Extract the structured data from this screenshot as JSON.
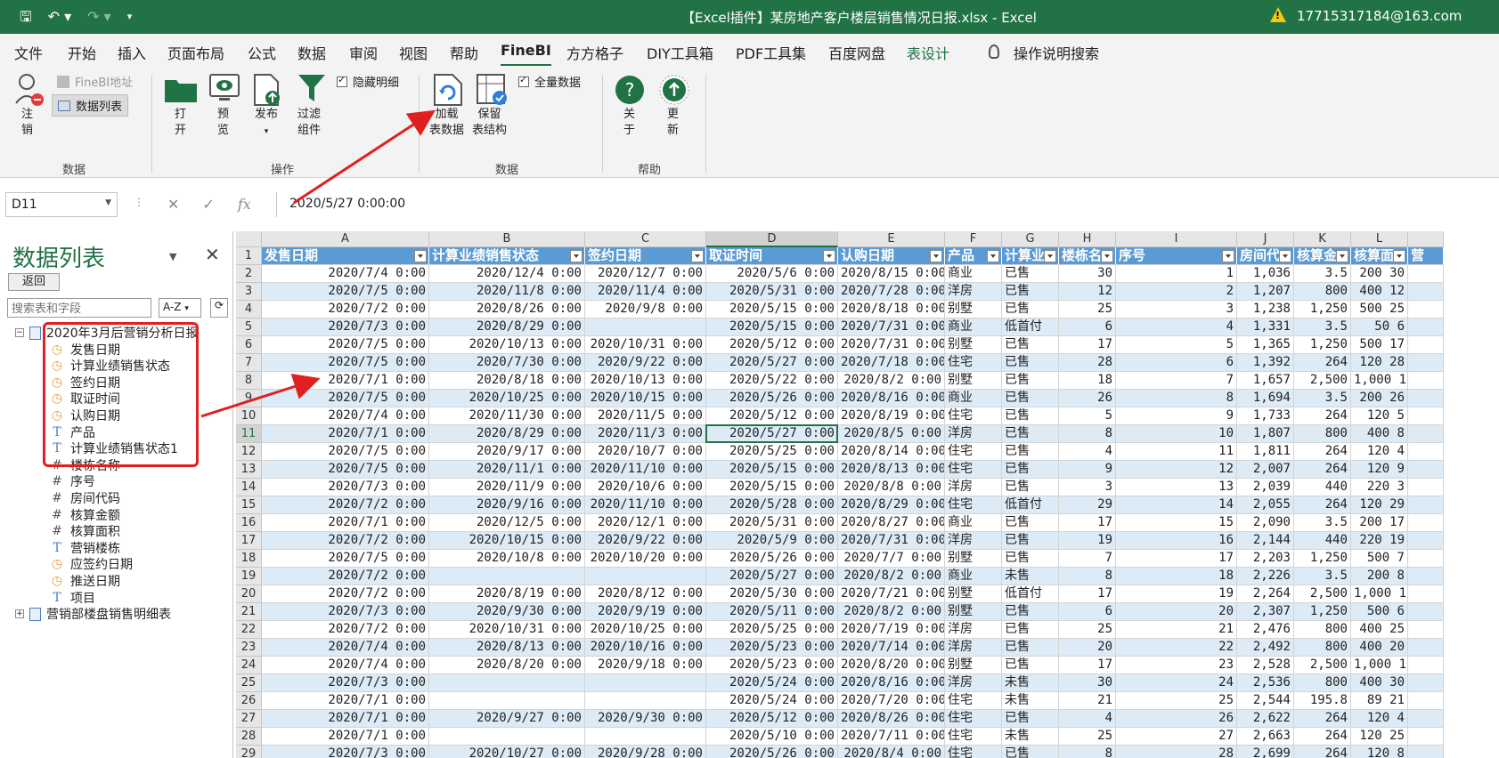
{
  "titlebar": {
    "title": "【Excel插件】某房地产客户楼层销售情况日报.xlsx  -  Excel",
    "user": "17715317184@163.com",
    "qat": [
      "save-icon",
      "undo-icon",
      "redo-icon",
      "customize-icon"
    ]
  },
  "menu": {
    "tabs": [
      "文件",
      "开始",
      "插入",
      "页面布局",
      "公式",
      "数据",
      "审阅",
      "视图",
      "帮助",
      "FineBI",
      "方方格子",
      "DIY工具箱",
      "PDF工具集",
      "百度网盘",
      "表设计"
    ],
    "active": "FineBI",
    "search": "操作说明搜索"
  },
  "ribbon": {
    "groups": {
      "data": "数据",
      "ops": "操作",
      "data2": "数据",
      "help": "帮助"
    },
    "buttons": {
      "logout": "注\n销",
      "finebi_addr": "FineBI地址",
      "data_list": "数据列表",
      "open": "打\n开",
      "preview": "预\n览",
      "publish": "发布",
      "filter": "过滤\n组件",
      "hide_detail": "隐藏明细",
      "load": "加载\n表数据",
      "keep": "保留\n表结构",
      "all_data": "全量数据",
      "about": "关\n于",
      "update": "更\n新"
    }
  },
  "formula": {
    "namebox": "D11",
    "fx": "fx",
    "value": "2020/5/27  0:00:00"
  },
  "pane": {
    "title": "数据列表",
    "back": "返回",
    "search_placeholder": "搜索表和字段",
    "sort": "A-Z",
    "tree": [
      {
        "label": "2020年3月后营销分析日报",
        "type": "table",
        "toggle": "−"
      },
      {
        "label": "发售日期",
        "type": "date"
      },
      {
        "label": "计算业绩销售状态",
        "type": "date"
      },
      {
        "label": "签约日期",
        "type": "date"
      },
      {
        "label": "取证时间",
        "type": "date"
      },
      {
        "label": "认购日期",
        "type": "date"
      },
      {
        "label": "产品",
        "type": "text"
      },
      {
        "label": "计算业绩销售状态1",
        "type": "text"
      },
      {
        "label": "楼栋名称",
        "type": "num"
      },
      {
        "label": "序号",
        "type": "num"
      },
      {
        "label": "房间代码",
        "type": "num"
      },
      {
        "label": "核算金额",
        "type": "num"
      },
      {
        "label": "核算面积",
        "type": "num"
      },
      {
        "label": "营销楼栋",
        "type": "text"
      },
      {
        "label": "应签约日期",
        "type": "date"
      },
      {
        "label": "推送日期",
        "type": "date"
      },
      {
        "label": "项目",
        "type": "text"
      },
      {
        "label": "营销部楼盘销售明细表",
        "type": "table",
        "toggle": "+"
      }
    ]
  },
  "sheet": {
    "columns": [
      "A",
      "B",
      "C",
      "D",
      "E",
      "F",
      "G",
      "H",
      "I",
      "J",
      "K",
      "L",
      ""
    ],
    "headers": [
      "发售日期",
      "计算业绩销售状态",
      "签约日期",
      "取证时间",
      "认购日期",
      "产品",
      "计算业",
      "楼栋名",
      "序号",
      "房间代",
      "核算金",
      "核算面",
      "营"
    ],
    "selected_cell": "D11",
    "rows": [
      [
        "2020/7/4 0:00",
        "2020/12/4 0:00",
        "2020/12/7 0:00",
        "2020/5/6 0:00",
        "2020/8/15 0:00",
        "商业",
        "已售",
        "30",
        "1",
        "1,036",
        "3.5",
        "200 30"
      ],
      [
        "2020/7/5 0:00",
        "2020/11/8 0:00",
        "2020/11/4 0:00",
        "2020/5/31 0:00",
        "2020/7/28 0:00",
        "洋房",
        "已售",
        "12",
        "2",
        "1,207",
        "800",
        "400 12"
      ],
      [
        "2020/7/2 0:00",
        "2020/8/26 0:00",
        "2020/9/8 0:00",
        "2020/5/15 0:00",
        "2020/8/18 0:00",
        "别墅",
        "已售",
        "25",
        "3",
        "1,238",
        "1,250",
        "500 25"
      ],
      [
        "2020/7/3 0:00",
        "2020/8/29 0:00",
        "",
        "2020/5/15 0:00",
        "2020/7/31 0:00",
        "商业",
        "低首付",
        "6",
        "4",
        "1,331",
        "3.5",
        "50 6"
      ],
      [
        "2020/7/5 0:00",
        "2020/10/13 0:00",
        "2020/10/31 0:00",
        "2020/5/12 0:00",
        "2020/7/31 0:00",
        "别墅",
        "已售",
        "17",
        "5",
        "1,365",
        "1,250",
        "500 17"
      ],
      [
        "2020/7/5 0:00",
        "2020/7/30 0:00",
        "2020/9/22 0:00",
        "2020/5/27 0:00",
        "2020/7/18 0:00",
        "住宅",
        "已售",
        "28",
        "6",
        "1,392",
        "264",
        "120 28"
      ],
      [
        "2020/7/1 0:00",
        "2020/8/18 0:00",
        "2020/10/13 0:00",
        "2020/5/22 0:00",
        "2020/8/2 0:00",
        "别墅",
        "已售",
        "18",
        "7",
        "1,657",
        "2,500",
        "1,000 18"
      ],
      [
        "2020/7/5 0:00",
        "2020/10/25 0:00",
        "2020/10/15 0:00",
        "2020/5/26 0:00",
        "2020/8/16 0:00",
        "商业",
        "已售",
        "26",
        "8",
        "1,694",
        "3.5",
        "200 26"
      ],
      [
        "2020/7/4 0:00",
        "2020/11/30 0:00",
        "2020/11/5 0:00",
        "2020/5/12 0:00",
        "2020/8/19 0:00",
        "住宅",
        "已售",
        "5",
        "9",
        "1,733",
        "264",
        "120 5"
      ],
      [
        "2020/7/1 0:00",
        "2020/8/29 0:00",
        "2020/11/3 0:00",
        "2020/5/27 0:00",
        "2020/8/5 0:00",
        "洋房",
        "已售",
        "8",
        "10",
        "1,807",
        "800",
        "400 8"
      ],
      [
        "2020/7/5 0:00",
        "2020/9/17 0:00",
        "2020/10/7 0:00",
        "2020/5/25 0:00",
        "2020/8/14 0:00",
        "住宅",
        "已售",
        "4",
        "11",
        "1,811",
        "264",
        "120 4"
      ],
      [
        "2020/7/5 0:00",
        "2020/11/1 0:00",
        "2020/11/10 0:00",
        "2020/5/15 0:00",
        "2020/8/13 0:00",
        "住宅",
        "已售",
        "9",
        "12",
        "2,007",
        "264",
        "120 9"
      ],
      [
        "2020/7/3 0:00",
        "2020/11/9 0:00",
        "2020/10/6 0:00",
        "2020/5/15 0:00",
        "2020/8/8 0:00",
        "洋房",
        "已售",
        "3",
        "13",
        "2,039",
        "440",
        "220 3"
      ],
      [
        "2020/7/2 0:00",
        "2020/9/16 0:00",
        "2020/11/10 0:00",
        "2020/5/28 0:00",
        "2020/8/29 0:00",
        "住宅",
        "低首付",
        "29",
        "14",
        "2,055",
        "264",
        "120 29"
      ],
      [
        "2020/7/1 0:00",
        "2020/12/5 0:00",
        "2020/12/1 0:00",
        "2020/5/31 0:00",
        "2020/8/27 0:00",
        "商业",
        "已售",
        "17",
        "15",
        "2,090",
        "3.5",
        "200 17"
      ],
      [
        "2020/7/2 0:00",
        "2020/10/15 0:00",
        "2020/9/22 0:00",
        "2020/5/9 0:00",
        "2020/7/31 0:00",
        "洋房",
        "已售",
        "19",
        "16",
        "2,144",
        "440",
        "220 19"
      ],
      [
        "2020/7/5 0:00",
        "2020/10/8 0:00",
        "2020/10/20 0:00",
        "2020/5/26 0:00",
        "2020/7/7 0:00",
        "别墅",
        "已售",
        "7",
        "17",
        "2,203",
        "1,250",
        "500 7"
      ],
      [
        "2020/7/2 0:00",
        "",
        "",
        "2020/5/27 0:00",
        "2020/8/2 0:00",
        "商业",
        "未售",
        "8",
        "18",
        "2,226",
        "3.5",
        "200 8"
      ],
      [
        "2020/7/2 0:00",
        "2020/8/19 0:00",
        "2020/8/12 0:00",
        "2020/5/30 0:00",
        "2020/7/21 0:00",
        "别墅",
        "低首付",
        "17",
        "19",
        "2,264",
        "2,500",
        "1,000 17"
      ],
      [
        "2020/7/3 0:00",
        "2020/9/30 0:00",
        "2020/9/19 0:00",
        "2020/5/11 0:00",
        "2020/8/2 0:00",
        "别墅",
        "已售",
        "6",
        "20",
        "2,307",
        "1,250",
        "500 6"
      ],
      [
        "2020/7/2 0:00",
        "2020/10/31 0:00",
        "2020/10/25 0:00",
        "2020/5/25 0:00",
        "2020/7/19 0:00",
        "洋房",
        "已售",
        "25",
        "21",
        "2,476",
        "800",
        "400 25"
      ],
      [
        "2020/7/4 0:00",
        "2020/8/13 0:00",
        "2020/10/16 0:00",
        "2020/5/23 0:00",
        "2020/7/14 0:00",
        "洋房",
        "已售",
        "20",
        "22",
        "2,492",
        "800",
        "400 20"
      ],
      [
        "2020/7/4 0:00",
        "2020/8/20 0:00",
        "2020/9/18 0:00",
        "2020/5/23 0:00",
        "2020/8/20 0:00",
        "别墅",
        "已售",
        "17",
        "23",
        "2,528",
        "2,500",
        "1,000 17"
      ],
      [
        "2020/7/3 0:00",
        "",
        "",
        "2020/5/24 0:00",
        "2020/8/16 0:00",
        "洋房",
        "未售",
        "30",
        "24",
        "2,536",
        "800",
        "400 30"
      ],
      [
        "2020/7/1 0:00",
        "",
        "",
        "2020/5/24 0:00",
        "2020/7/20 0:00",
        "住宅",
        "未售",
        "21",
        "25",
        "2,544",
        "195.8",
        "89 21"
      ],
      [
        "2020/7/1 0:00",
        "2020/9/27 0:00",
        "2020/9/30 0:00",
        "2020/5/12 0:00",
        "2020/8/26 0:00",
        "住宅",
        "已售",
        "4",
        "26",
        "2,622",
        "264",
        "120 4"
      ],
      [
        "2020/7/1 0:00",
        "",
        "",
        "2020/5/10 0:00",
        "2020/7/11 0:00",
        "住宅",
        "未售",
        "25",
        "27",
        "2,663",
        "264",
        "120 25"
      ],
      [
        "2020/7/3 0:00",
        "2020/10/27 0:00",
        "2020/9/28 0:00",
        "2020/5/26 0:00",
        "2020/8/4 0:00",
        "住宅",
        "已售",
        "8",
        "28",
        "2,699",
        "264",
        "120 8"
      ]
    ]
  },
  "colors": {
    "excel_green": "#217346",
    "table_header": "#5b9bd5",
    "band": "#ddebf7",
    "annotation_red": "#e02020"
  }
}
